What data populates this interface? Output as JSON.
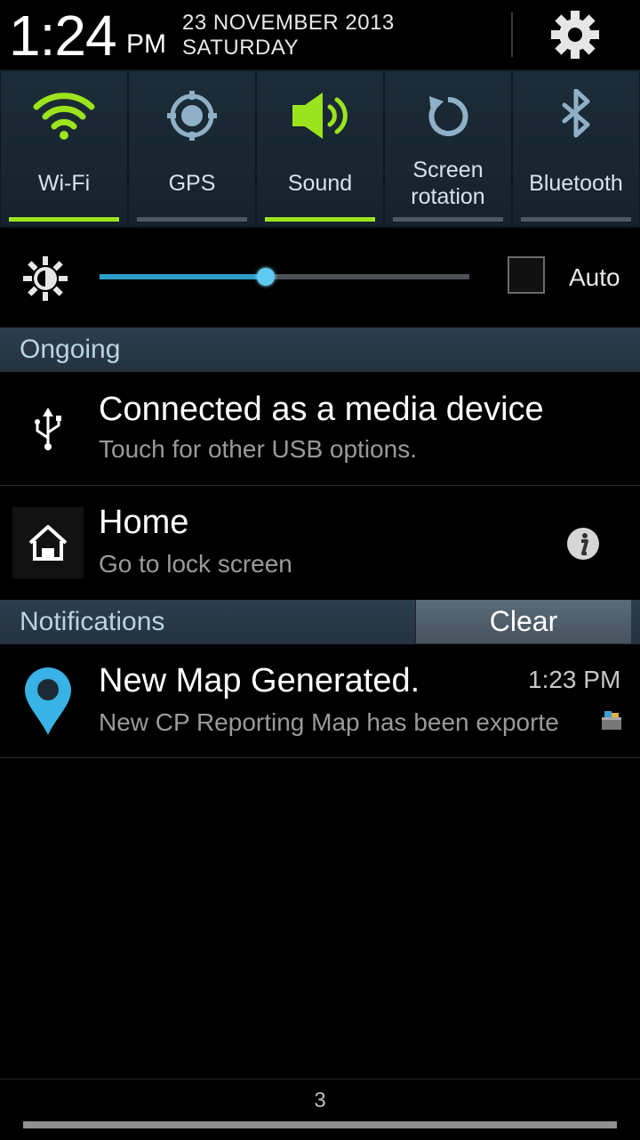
{
  "header": {
    "time": "1:24",
    "ampm": "PM",
    "date": "23 NOVEMBER 2013",
    "day": "SATURDAY",
    "settings_icon": "gear-icon"
  },
  "toggles": [
    {
      "label": "Wi-Fi",
      "icon": "wifi-icon",
      "on": true
    },
    {
      "label": "GPS",
      "icon": "gps-icon",
      "on": false
    },
    {
      "label": "Sound",
      "icon": "sound-icon",
      "on": true
    },
    {
      "label": "Screen rotation",
      "line1": "Screen",
      "line2": "rotation",
      "icon": "rotate-icon",
      "on": false
    },
    {
      "label": "Bluetooth",
      "icon": "bluetooth-icon",
      "on": false
    }
  ],
  "brightness": {
    "level": 0.45,
    "auto_label": "Auto",
    "auto_checked": false
  },
  "ongoing": {
    "header": "Ongoing",
    "items": [
      {
        "title": "Connected as a media device",
        "subtitle": "Touch for other USB options.",
        "icon": "usb-icon"
      },
      {
        "title": "Home",
        "subtitle": "Go to lock screen",
        "icon": "home-icon"
      }
    ]
  },
  "notifications": {
    "header": "Notifications",
    "clear_label": "Clear",
    "items": [
      {
        "title": "New Map Generated.",
        "subtitle": "New CP Reporting Map has been exporte",
        "time": "1:23 PM",
        "icon": "map-pin-icon"
      }
    ]
  },
  "pager": {
    "page_label": "3"
  },
  "colors": {
    "accent_on": "#9be41d",
    "slider": "#2f9cc7",
    "section": "#2c3e4e"
  }
}
